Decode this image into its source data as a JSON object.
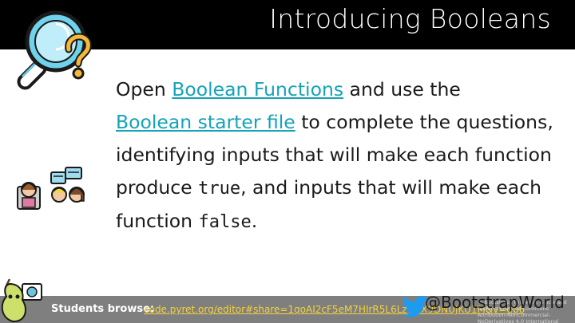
{
  "slide": {
    "title": "Introducing Booleans",
    "body": {
      "open": "Open ",
      "link1": "Boolean Functions",
      "mid1": " and use the",
      "link2": "Boolean starter file",
      "mid2": " to complete the questions, identifying inputs that will make each function produce ",
      "code_true": "true",
      "mid3": ", and inputs that will make each function ",
      "code_false": "false",
      "end": "."
    }
  },
  "footer": {
    "students_label": "Students browse:",
    "students_url": "code.pyret.org/editor#share=1qoAI2cF5eM7HIrR5L6LzOAX9DNUJKU1M&v=db6",
    "license": "© Bootstrap. This work is licensed under a Creative Commons Attribution-NonCommercial-NoDerivatives 4.0 International License. bootstrapworld.org",
    "handle": "@BootstrapWorld"
  },
  "icons": {
    "magnifier": "magnifier-question-icon",
    "people": "people-chatting-icon",
    "pear": "pyret-pear-mascot-icon",
    "twitter": "twitter-bird-icon"
  },
  "colors": {
    "title_bar": "#000000",
    "link": "#14a3b8",
    "footer_bar": "#7f7f7f",
    "footer_url": "#f5d33a",
    "twitter": "#1d9bf0"
  }
}
